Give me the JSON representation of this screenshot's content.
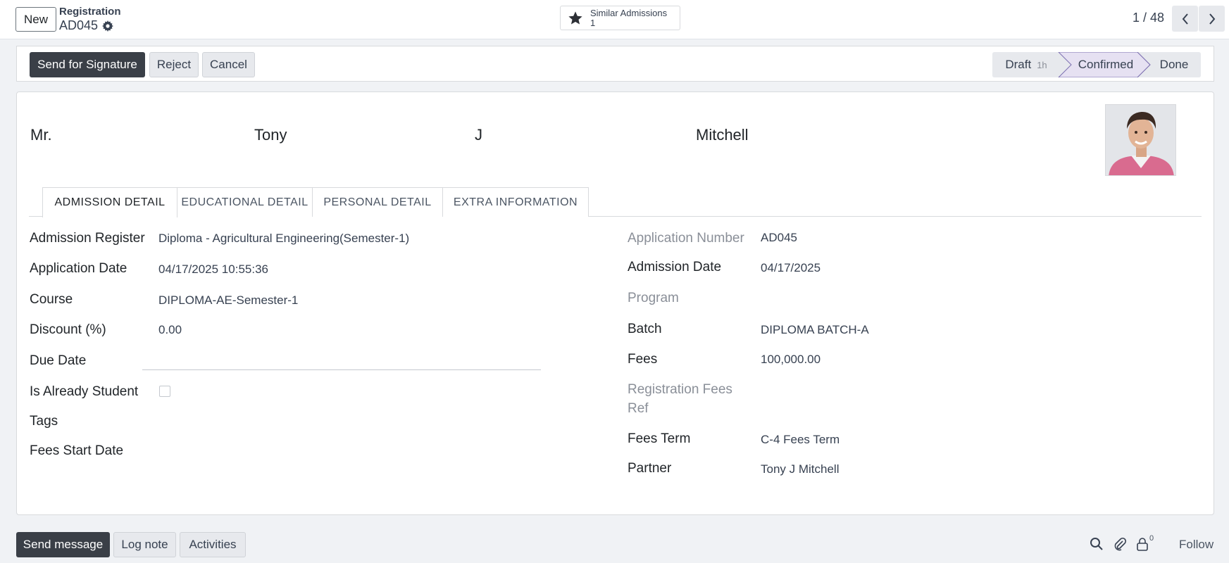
{
  "header": {
    "new_label": "New",
    "breadcrumb_title": "Registration",
    "record_id": "AD045",
    "smart_button_label": "Similar Admissions",
    "smart_button_count": "1",
    "pager": "1 / 48"
  },
  "statusbar": {
    "send_signature_label": "Send for Signature",
    "reject_label": "Reject",
    "cancel_label": "Cancel",
    "stages": [
      {
        "label": "Draft",
        "duration": "1h",
        "state": "current"
      },
      {
        "label": "Confirmed",
        "state": "next"
      },
      {
        "label": "Done",
        "state": "future"
      }
    ]
  },
  "student": {
    "title": "Mr.",
    "first_name": "Tony",
    "middle_name": "J",
    "last_name": "Mitchell"
  },
  "tabs": [
    "ADMISSION DETAIL",
    "EDUCATIONAL DETAIL",
    "PERSONAL DETAIL",
    "EXTRA INFORMATION"
  ],
  "left_fields": {
    "admission_register": {
      "label": "Admission Register",
      "value": "Diploma - Agricultural Engineering(Semester-1)"
    },
    "application_date": {
      "label": "Application Date",
      "value": "04/17/2025 10:55:36"
    },
    "course": {
      "label": "Course",
      "value": "DIPLOMA-AE-Semester-1"
    },
    "discount": {
      "label": "Discount (%)",
      "value": "0.00"
    },
    "due_date": {
      "label": "Due Date",
      "value": ""
    },
    "is_already_student": {
      "label": "Is Already Student",
      "checked": false
    },
    "tags": {
      "label": "Tags",
      "value": ""
    },
    "fees_start_date": {
      "label": "Fees Start Date",
      "value": ""
    }
  },
  "right_fields": {
    "application_number": {
      "label": "Application Number",
      "value": "AD045"
    },
    "admission_date": {
      "label": "Admission Date",
      "value": "04/17/2025"
    },
    "program": {
      "label": "Program",
      "value": ""
    },
    "batch": {
      "label": "Batch",
      "value": "DIPLOMA BATCH-A"
    },
    "fees": {
      "label": "Fees",
      "value": "100,000.00"
    },
    "registration_fees_ref_line1": "Registration Fees",
    "registration_fees_ref_line2": "Ref",
    "fees_term": {
      "label": "Fees Term",
      "value": "C-4 Fees Term"
    },
    "partner": {
      "label": "Partner",
      "value": "Tony J Mitchell"
    }
  },
  "chatter": {
    "send_message_label": "Send message",
    "log_note_label": "Log note",
    "activities_label": "Activities",
    "follower_count": "0",
    "follow_label": "Follow"
  },
  "colors": {
    "dark_button": "#3a3f47",
    "confirmed_stage": "#e6e1f2",
    "confirmed_border": "#7b6fb0"
  }
}
